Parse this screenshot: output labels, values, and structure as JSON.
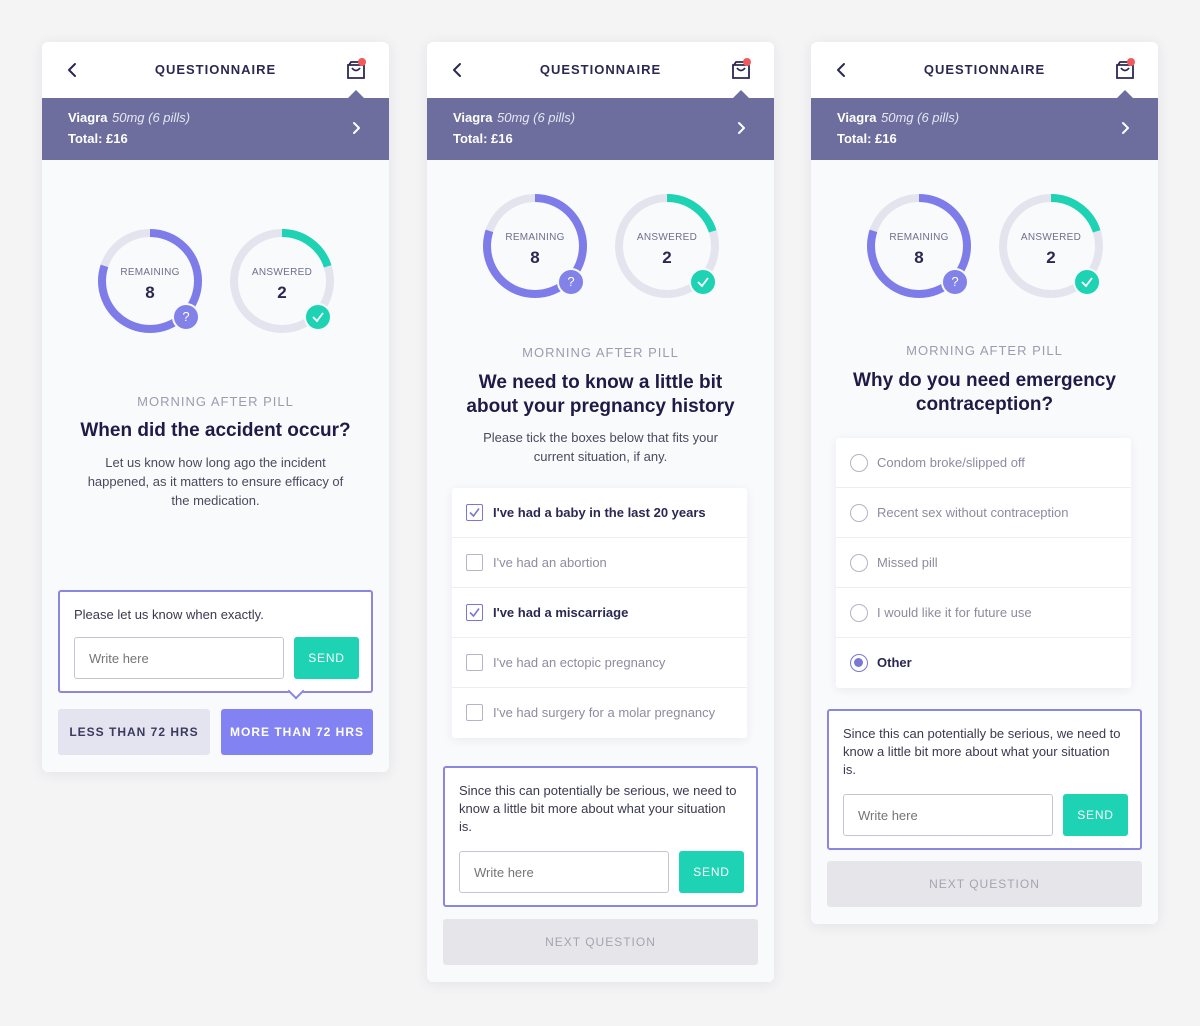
{
  "colors": {
    "accent": "#8282e8",
    "teal": "#1ed2b4",
    "banner": "#6e6e9e",
    "ring_track": "#e4e4ef",
    "notification": "#f05a5a"
  },
  "screens": [
    {
      "header": {
        "title": "QUESTIONNAIRE",
        "back_icon": "chevron-left-icon",
        "cart_icon": "shopping-bag-icon"
      },
      "product": {
        "name": "Viagra",
        "dose": "50mg (6 pills)",
        "total": "Total: £16"
      },
      "progress": {
        "remaining": {
          "label": "REMAINING",
          "value": "8",
          "fraction": 0.8
        },
        "answered": {
          "label": "ANSWERED",
          "value": "2",
          "fraction": 0.2
        }
      },
      "category": "MORNING AFTER PILL",
      "question": "When did the accident occur?",
      "description": "Let us know how long ago the incident happened, as it matters to ensure efficacy of the medication.",
      "message": {
        "text": "Please let us know when exactly.",
        "placeholder": "Write here",
        "send_label": "SEND"
      },
      "choices": [
        "LESS THAN 72 HRS",
        "MORE THAN 72 HRS"
      ]
    },
    {
      "header": {
        "title": "QUESTIONNAIRE"
      },
      "product": {
        "name": "Viagra",
        "dose": "50mg (6 pills)",
        "total": "Total: £16"
      },
      "progress": {
        "remaining": {
          "label": "REMAINING",
          "value": "8",
          "fraction": 0.8
        },
        "answered": {
          "label": "ANSWERED",
          "value": "2",
          "fraction": 0.2
        }
      },
      "category": "MORNING AFTER PILL",
      "question": "We need to know a little bit about your pregnancy history",
      "description": "Please tick the boxes below that fits your current situation, if any.",
      "options": [
        {
          "label": "I've had a baby in the last 20 years",
          "checked": true
        },
        {
          "label": "I've had an abortion",
          "checked": false
        },
        {
          "label": "I've had a miscarriage",
          "checked": true
        },
        {
          "label": "I've had an ectopic pregnancy",
          "checked": false
        },
        {
          "label": "I've had surgery for a molar pregnancy",
          "checked": false
        }
      ],
      "message": {
        "text": "Since this can potentially be serious, we need to know a little bit more about what your situation is.",
        "placeholder": "Write here",
        "send_label": "SEND"
      },
      "next_label": "NEXT QUESTION"
    },
    {
      "header": {
        "title": "QUESTIONNAIRE"
      },
      "product": {
        "name": "Viagra",
        "dose": "50mg (6 pills)",
        "total": "Total: £16"
      },
      "progress": {
        "remaining": {
          "label": "REMAINING",
          "value": "8",
          "fraction": 0.8
        },
        "answered": {
          "label": "ANSWERED",
          "value": "2",
          "fraction": 0.2
        }
      },
      "category": "MORNING AFTER PILL",
      "question": "Why do you need emergency contraception?",
      "options": [
        {
          "label": "Condom broke/slipped off",
          "selected": false
        },
        {
          "label": "Recent sex without contraception",
          "selected": false
        },
        {
          "label": "Missed pill",
          "selected": false
        },
        {
          "label": "I would like it for future use",
          "selected": false
        },
        {
          "label": "Other",
          "selected": true
        }
      ],
      "message": {
        "text": "Since this can potentially be serious, we need to know a little bit more about what your situation is.",
        "placeholder": "Write here",
        "send_label": "SEND"
      },
      "next_label": "NEXT QUESTION"
    }
  ]
}
